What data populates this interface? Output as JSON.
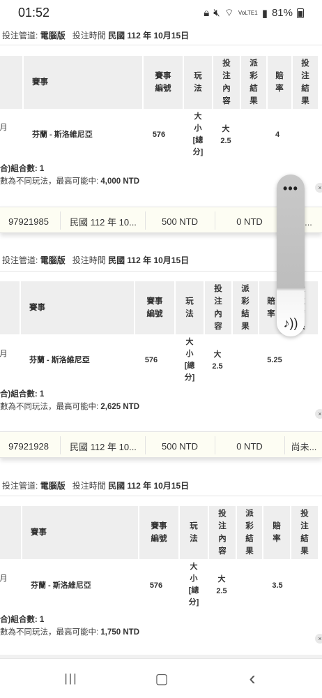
{
  "status": {
    "time": "01:52",
    "battery": "81%",
    "signal": "VoLTE1"
  },
  "blocks": [
    {
      "info": {
        "channel_label": "投注管道:",
        "channel": "電腦版",
        "time_label": "投注時間",
        "time": "民國 112 年 10月15日"
      },
      "headers": [
        "賽事",
        "賽事編號",
        "玩法",
        "投注內容",
        "派彩結果",
        "賠率",
        "投注結果"
      ],
      "left_cut": "月",
      "row": {
        "match": "芬蘭 - 斯洛維尼亞",
        "id": "576",
        "play": "大小[總分]",
        "content": "大 2.5",
        "payout": "",
        "odds": "4",
        "result": ""
      },
      "combo": "合)組合數: 1",
      "maxwin_label": "數為不同玩法，最高可能中:",
      "maxwin": "4,000 NTD"
    },
    {
      "info": {
        "channel_label": "投注管道:",
        "channel": "電腦版",
        "time_label": "投注時間",
        "time": "民國 112 年 10月15日"
      },
      "headers": [
        "賽事",
        "賽事編號",
        "玩法",
        "投注內容",
        "派彩結果",
        "賠率",
        "投注結果"
      ],
      "left_cut": "月",
      "row": {
        "match": "芬蘭 - 斯洛維尼亞",
        "id": "576",
        "play": "大小[總分]",
        "content": "大 2.5",
        "payout": "",
        "odds": "5.25",
        "result": ""
      },
      "combo": "合)組合數: 1",
      "maxwin_label": "數為不同玩法，最高可能中:",
      "maxwin": "2,625 NTD"
    },
    {
      "info": {
        "channel_label": "投注管道:",
        "channel": "電腦版",
        "time_label": "投注時間",
        "time": "民國 112 年 10月15日"
      },
      "headers": [
        "賽事",
        "賽事編號",
        "玩法",
        "投注內容",
        "派彩結果",
        "賠率",
        "投注結果"
      ],
      "left_cut": "月",
      "row": {
        "match": "芬蘭 - 斯洛維尼亞",
        "id": "576",
        "play": "大小[總分]",
        "content": "大 2.5",
        "payout": "",
        "odds": "3.5",
        "result": ""
      },
      "combo": "合)組合數: 1",
      "maxwin_label": "數為不同玩法，最高可能中:",
      "maxwin": "1,750 NTD"
    }
  ],
  "summaries": [
    {
      "order_id": "97921985",
      "date": "民國 112 年 10...",
      "stake": "500 NTD",
      "payout": "0 NTD",
      "status": "未..."
    },
    {
      "order_id": "97921928",
      "date": "民國 112 年 10...",
      "stake": "500 NTD",
      "payout": "0 NTD",
      "status": "尚未..."
    }
  ],
  "float_panel": {
    "menu_icon": "more-dots-icon",
    "music_icon": "music-note-icon",
    "menu_glyph": "•••",
    "music_glyph": "♪))"
  },
  "edge_close_glyph": "×",
  "nav": {
    "recents_glyph": "|||",
    "home_glyph": "▢",
    "back_glyph": "‹"
  }
}
